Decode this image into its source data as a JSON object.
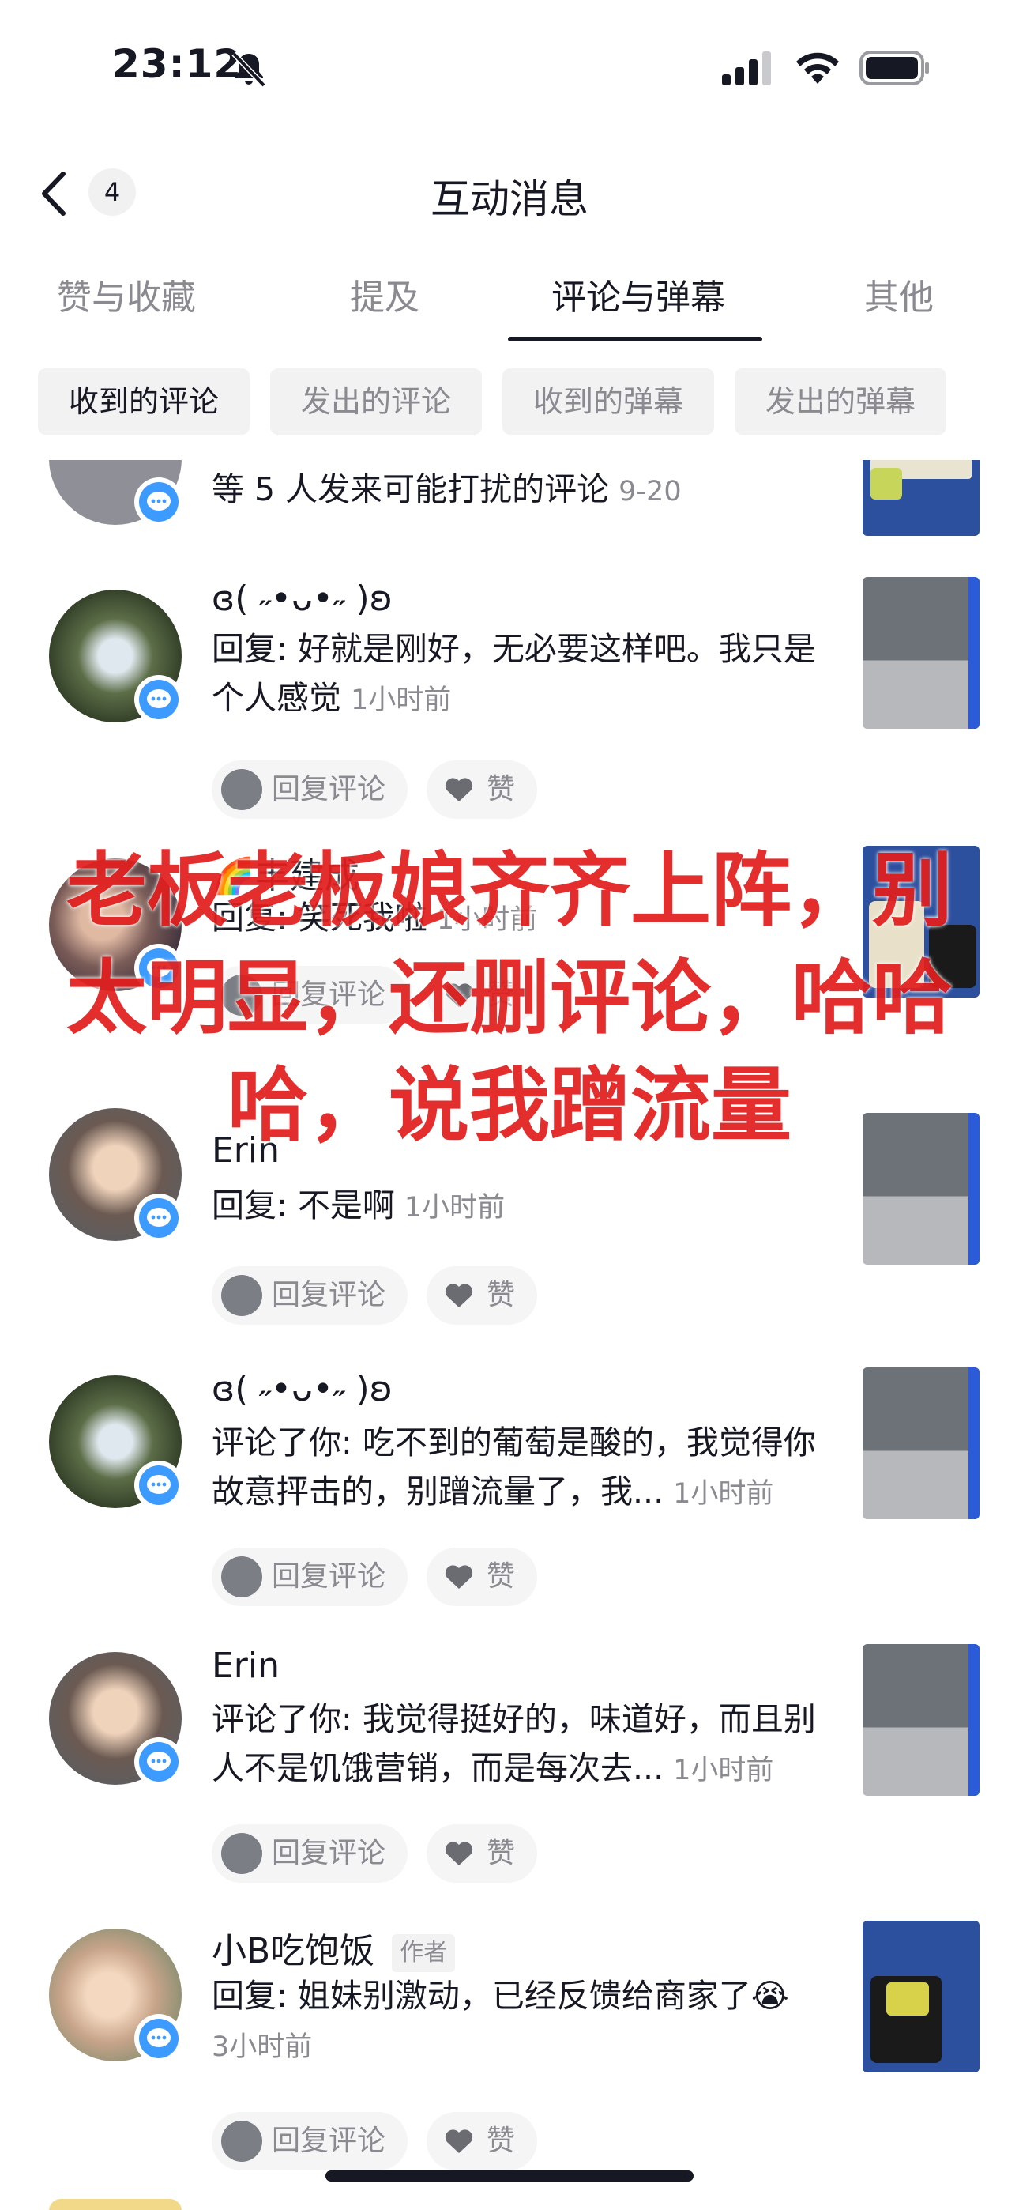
{
  "status_bar": {
    "time": "23:12"
  },
  "nav": {
    "back_count": "4",
    "title": "互动消息"
  },
  "tabs": [
    {
      "label": "赞与收藏"
    },
    {
      "label": "提及"
    },
    {
      "label": "评论与弹幕"
    },
    {
      "label": "其他"
    }
  ],
  "subtabs": [
    {
      "label": "收到的评论"
    },
    {
      "label": "发出的评论"
    },
    {
      "label": "收到的弹幕"
    },
    {
      "label": "发出的弹幕"
    }
  ],
  "items": [
    {
      "text": "等 5 人发来可能打扰的评论",
      "time": "9-20"
    },
    {
      "name": "ɞ( ˶•ᴗ•˶ )ʚ",
      "text": "回复: 好就是刚好，无必要这样吧。我只是个人感觉",
      "time": "1小时前"
    },
    {
      "name": "🌈丰建成",
      "text": "回复: 笑死我啦",
      "time": "1小时前"
    },
    {
      "name": "Erin",
      "text": "回复: 不是啊",
      "time": "1小时前"
    },
    {
      "name": "ɞ( ˶•ᴗ•˶ )ʚ",
      "text": "评论了你: 吃不到的葡萄是酸的，我觉得你故意抨击的，别蹭流量了，我...",
      "time": "1小时前"
    },
    {
      "name": "Erin",
      "text": "评论了你: 我觉得挺好的，味道好，而且别人不是饥饿营销，而是每次去...",
      "time": "1小时前"
    },
    {
      "name": "小B吃饱饭",
      "author_badge": "作者",
      "text": "回复: 姐妹别激动，已经反馈给商家了😭",
      "time": "3小时前"
    }
  ],
  "actions": {
    "reply_label": "回复评论",
    "like_label": "赞"
  },
  "overlay_caption": "老板老板娘齐齐上阵，别太明显，还删评论，哈哈哈，说我蹭流量",
  "colors": {
    "accent_blue": "#3d9bff",
    "overlay_red": "#e21f1f",
    "text_primary": "#161823",
    "text_secondary": "#8a8b91"
  }
}
